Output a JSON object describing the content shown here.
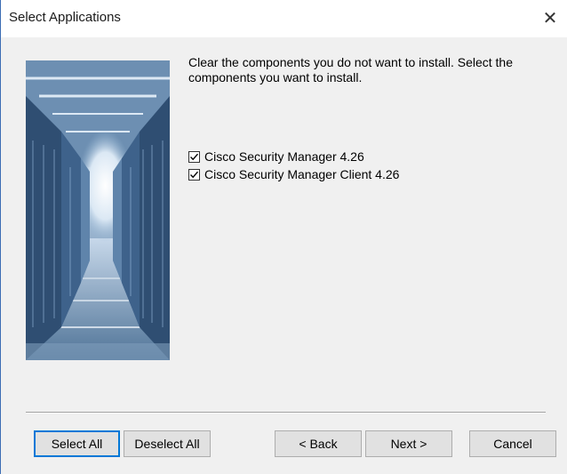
{
  "window": {
    "title": "Select Applications"
  },
  "instructions": "Clear the components you do not want to install. Select the components you want to install.",
  "components": [
    {
      "label": "Cisco Security Manager 4.26",
      "checked": true
    },
    {
      "label": "Cisco Security Manager Client 4.26",
      "checked": true
    }
  ],
  "buttons": {
    "select_all": "Select All",
    "deselect_all": "Deselect All",
    "back": "< Back",
    "next": "Next >",
    "cancel": "Cancel"
  },
  "icons": {
    "close": "close-icon",
    "checkmark": "checkmark-icon"
  }
}
